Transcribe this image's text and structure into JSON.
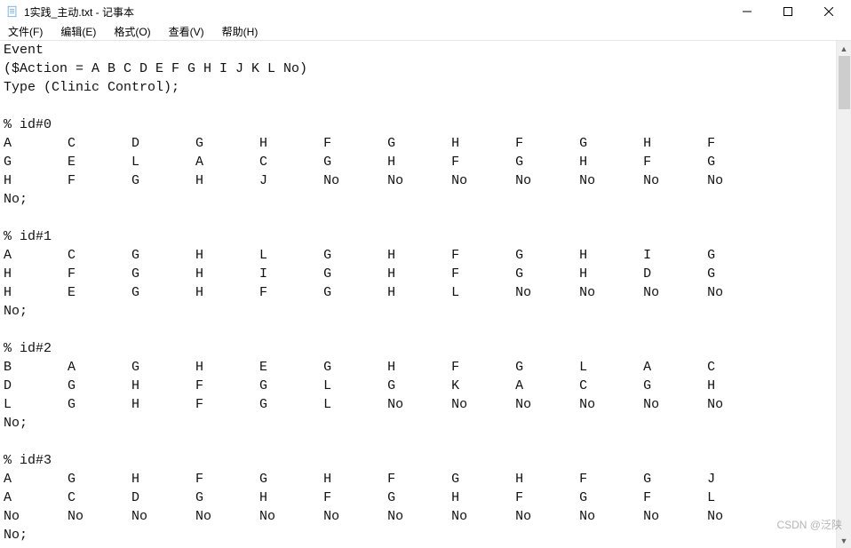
{
  "window": {
    "title": "1实践_主动.txt - 记事本"
  },
  "menu": {
    "file": "文件(F)",
    "edit": "编辑(E)",
    "format": "格式(O)",
    "view": "查看(V)",
    "help": "帮助(H)"
  },
  "content": {
    "text": "Event\n($Action = A B C D E F G H I J K L No)\nType (Clinic Control);\n\n% id#0\nA\tC\tD\tG\tH\tF\tG\tH\tF\tG\tH\tF\nG\tE\tL\tA\tC\tG\tH\tF\tG\tH\tF\tG\nH\tF\tG\tH\tJ\tNo\tNo\tNo\tNo\tNo\tNo\tNo\nNo;\n\n% id#1\nA\tC\tG\tH\tL\tG\tH\tF\tG\tH\tI\tG\nH\tF\tG\tH\tI\tG\tH\tF\tG\tH\tD\tG\nH\tE\tG\tH\tF\tG\tH\tL\tNo\tNo\tNo\tNo\nNo;\n\n% id#2\nB\tA\tG\tH\tE\tG\tH\tF\tG\tL\tA\tC\nD\tG\tH\tF\tG\tL\tG\tK\tA\tC\tG\tH\nL\tG\tH\tF\tG\tL\tNo\tNo\tNo\tNo\tNo\tNo\nNo;\n\n% id#3\nA\tG\tH\tF\tG\tH\tF\tG\tH\tF\tG\tJ\nA\tC\tD\tG\tH\tF\tG\tH\tF\tG\tF\tL\nNo\tNo\tNo\tNo\tNo\tNo\tNo\tNo\tNo\tNo\tNo\tNo\nNo;"
  },
  "watermark": "CSDN @泛陕"
}
